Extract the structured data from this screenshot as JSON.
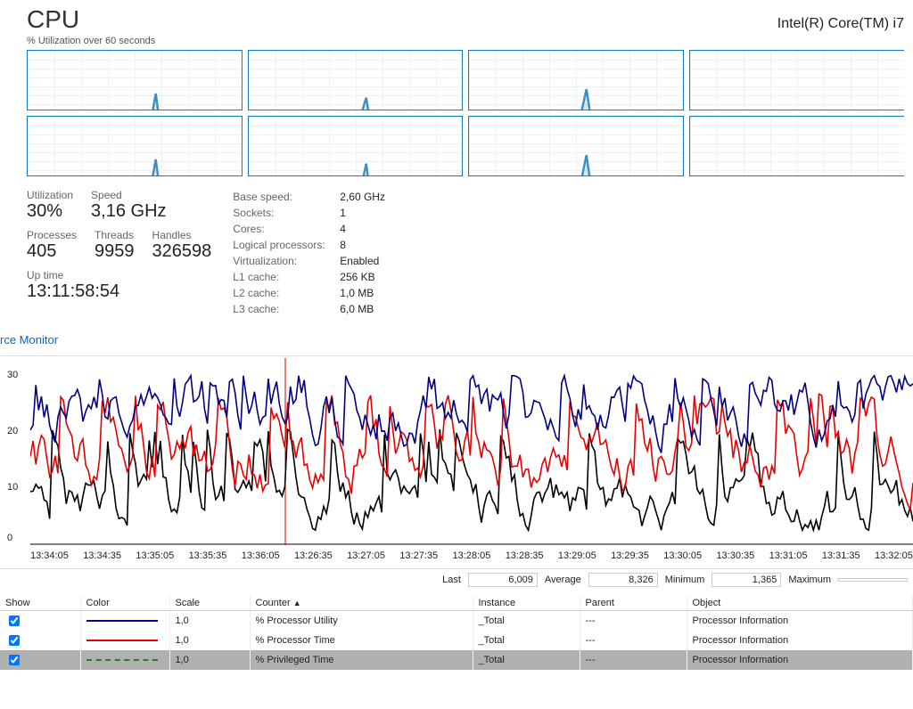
{
  "header": {
    "title": "CPU",
    "model": "Intel(R) Core(TM) i7",
    "subtitle": "% Utilization over 60 seconds"
  },
  "stats_left": {
    "util_label": "Utilization",
    "util_value": "30%",
    "speed_label": "Speed",
    "speed_value": "3,16 GHz",
    "proc_label": "Processes",
    "proc_value": "405",
    "threads_label": "Threads",
    "threads_value": "9959",
    "handles_label": "Handles",
    "handles_value": "326598",
    "uptime_label": "Up time",
    "uptime_value": "13:11:58:54"
  },
  "stats_right": {
    "base_speed_k": "Base speed:",
    "base_speed_v": "2,60 GHz",
    "sockets_k": "Sockets:",
    "sockets_v": "1",
    "cores_k": "Cores:",
    "cores_v": "4",
    "lp_k": "Logical processors:",
    "lp_v": "8",
    "virt_k": "Virtualization:",
    "virt_v": "Enabled",
    "l1_k": "L1 cache:",
    "l1_v": "256 KB",
    "l2_k": "L2 cache:",
    "l2_v": "1,0 MB",
    "l3_k": "L3 cache:",
    "l3_v": "6,0 MB"
  },
  "link_resmon": "rce Monitor",
  "summary": {
    "last_lbl": "Last",
    "last_val": "6,009",
    "avg_lbl": "Average",
    "avg_val": "8,326",
    "min_lbl": "Minimum",
    "min_val": "1,365",
    "max_lbl": "Maximum",
    "max_val": ""
  },
  "table": {
    "cols": {
      "show": "Show",
      "color": "Color",
      "scale": "Scale",
      "counter": "Counter",
      "instance": "Instance",
      "parent": "Parent",
      "object": "Object"
    },
    "rows": [
      {
        "scale": "1,0",
        "counter": "% Processor Utility",
        "instance": "_Total",
        "parent": "---",
        "object": "Processor Information"
      },
      {
        "scale": "1,0",
        "counter": "% Processor Time",
        "instance": "_Total",
        "parent": "---",
        "object": "Processor Information"
      },
      {
        "scale": "1,0",
        "counter": "% Privileged Time",
        "instance": "_Total",
        "parent": "---",
        "object": "Processor Information"
      }
    ]
  },
  "chart_data": [
    {
      "type": "line",
      "title": "% Utilization over 60 seconds (per logical processor)",
      "note": "8 mini charts, each ≈0-100% over 60s, values approximate",
      "series_count": 8,
      "ylim": [
        0,
        100
      ]
    },
    {
      "type": "line",
      "ylabel": "",
      "ylim": [
        0,
        35
      ],
      "y_ticks": [
        0,
        10,
        20,
        30
      ],
      "x_ticks": [
        "13:34:05",
        "13:34:35",
        "13:35:05",
        "13:35:35",
        "13:36:05",
        "13:26:35",
        "13:27:05",
        "13:27:35",
        "13:28:05",
        "13:28:35",
        "13:29:05",
        "13:29:35",
        "13:30:05",
        "13:30:35",
        "13:31:05",
        "13:31:35",
        "13:32:05"
      ],
      "series": [
        {
          "name": "% Processor Utility",
          "color": "#000080",
          "approx_mean": 24,
          "approx_range": [
            15,
            35
          ]
        },
        {
          "name": "% Processor Time",
          "color": "#e60000",
          "approx_mean": 15,
          "approx_range": [
            7,
            34
          ]
        },
        {
          "name": "% Privileged Time",
          "color": "#000000",
          "approx_mean": 7,
          "approx_range": [
            2,
            28
          ]
        }
      ]
    }
  ]
}
